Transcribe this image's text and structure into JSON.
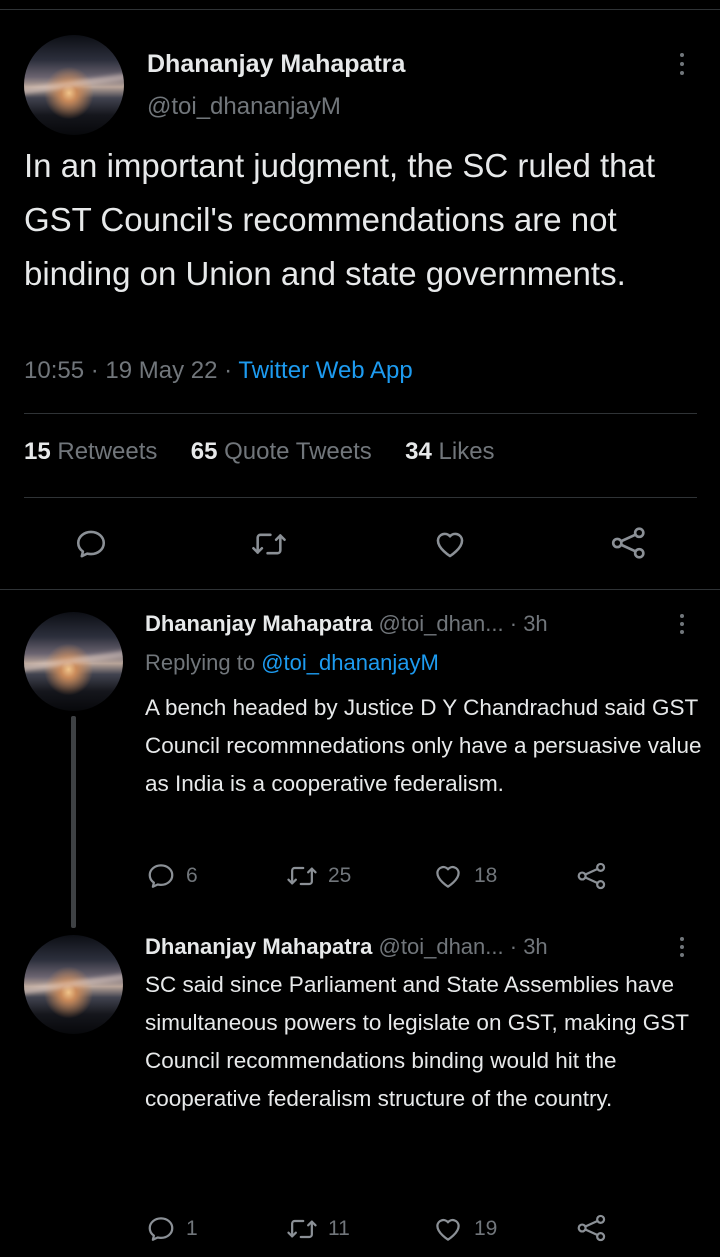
{
  "main_tweet": {
    "author_name": "Dhananjay Mahapatra",
    "author_handle": "@toi_dhananjayM",
    "text": "In an important judgment, the SC ruled that GST Council's recommendations are not binding on Union and state governments.",
    "time": "10:55",
    "date": "19 May 22",
    "separator": "·",
    "source": "Twitter Web App",
    "stats": {
      "retweets_count": "15",
      "retweets_label": "Retweets",
      "quotes_count": "65",
      "quotes_label": "Quote Tweets",
      "likes_count": "34",
      "likes_label": "Likes"
    },
    "icons": [
      "reply-icon",
      "retweet-icon",
      "like-icon",
      "share-icon"
    ]
  },
  "replies": [
    {
      "author_name": "Dhananjay Mahapatra",
      "author_handle": "@toi_dhan...",
      "age": "· 3h",
      "replying_prefix": "Replying to",
      "replying_to": "@toi_dhananjayM",
      "text": "A bench headed by Justice D Y Chandrachud said GST Council recommnedations only have a persuasive value as India is a cooperative federalism.",
      "reply_count": "6",
      "retweet_count": "25",
      "like_count": "18"
    },
    {
      "author_name": "Dhananjay Mahapatra",
      "author_handle": "@toi_dhan...",
      "age": "· 3h",
      "text": "SC said since Parliament and State Assemblies have simultaneous powers to legislate on GST, making GST Council recommendations binding would hit the cooperative federalism structure of the country.",
      "reply_count": "1",
      "retweet_count": "11",
      "like_count": "19"
    }
  ],
  "colors": {
    "background": "#000000",
    "text": "#e7e9ea",
    "secondary": "#71767b",
    "link": "#1d9bf0",
    "divider": "#2f3336"
  }
}
